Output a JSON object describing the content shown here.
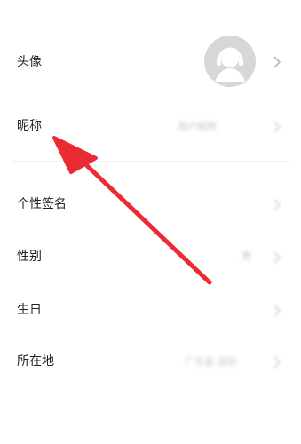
{
  "profile": {
    "rows": [
      {
        "label": "头像",
        "value": "",
        "icon": "avatar-headset-icon"
      },
      {
        "label": "昵称",
        "value": "用户昵称"
      },
      {
        "label": "个性签名",
        "value": ""
      },
      {
        "label": "性别",
        "value": "男"
      },
      {
        "label": "生日",
        "value": ""
      },
      {
        "label": "所在地",
        "value": "广东省 深圳"
      }
    ]
  },
  "colors": {
    "arrow": "#ea2b33",
    "label": "#222222",
    "chevron": "#b8b8b8",
    "avatar_bg": "#d7d7d7"
  }
}
